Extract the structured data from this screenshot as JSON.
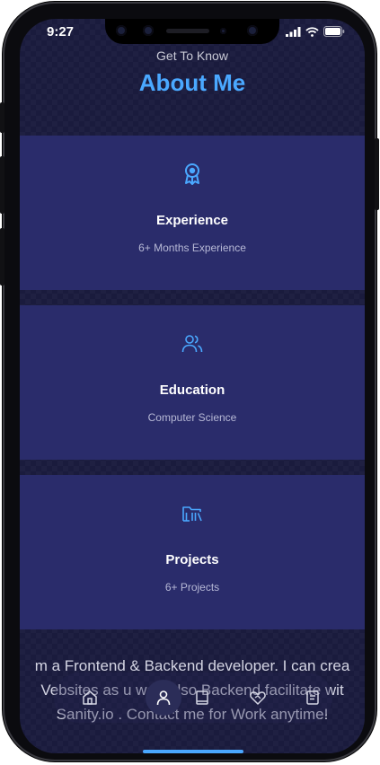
{
  "status_bar": {
    "time": "9:27",
    "icons": [
      "signal-icon",
      "wifi-icon",
      "battery-icon"
    ]
  },
  "header": {
    "subtitle": "Get To Know",
    "title": "About Me",
    "title_color": "#4aa8ff"
  },
  "cards": [
    {
      "icon": "award-icon",
      "label": "Experience",
      "detail": "6+ Months Experience"
    },
    {
      "icon": "users-icon",
      "label": "Education",
      "detail": "Computer Science"
    },
    {
      "icon": "folder-library-icon",
      "label": "Projects",
      "detail": "6+ Projects"
    }
  ],
  "bio": {
    "lines": [
      "m a Frontend & Backend developer. I can crea",
      "Vebsites as u wa  . Also Backend facilitate wit",
      "Sanity.io . Contact me for Work anytime!"
    ]
  },
  "bottom_nav": {
    "items": [
      "home-icon",
      "user-icon",
      "book-icon",
      "heart-handshake-icon",
      "message-icon"
    ],
    "active_index": 1
  },
  "colors": {
    "background": "#1a1b3d",
    "card": "#2a2c6b",
    "accent": "#4aa8ff"
  }
}
